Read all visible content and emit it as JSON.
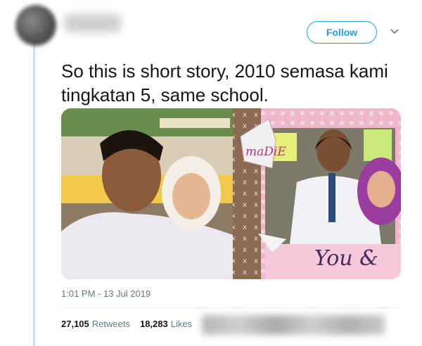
{
  "tweet": {
    "follow_label": "Follow",
    "text": "So this is short story, 2010 semasa kami tingkatan 5, same school.",
    "timestamp": "1:01 PM - 13 Jul 2019",
    "retweets_count": "27,105",
    "retweets_label": "Retweets",
    "likes_count": "18,283",
    "likes_label": "Likes"
  },
  "media": {
    "sticker_text": "maDiE",
    "caption_text": "You &"
  },
  "colors": {
    "accent": "#1da1f2",
    "thread_line": "#c3e3f5",
    "muted_text": "#657786"
  }
}
